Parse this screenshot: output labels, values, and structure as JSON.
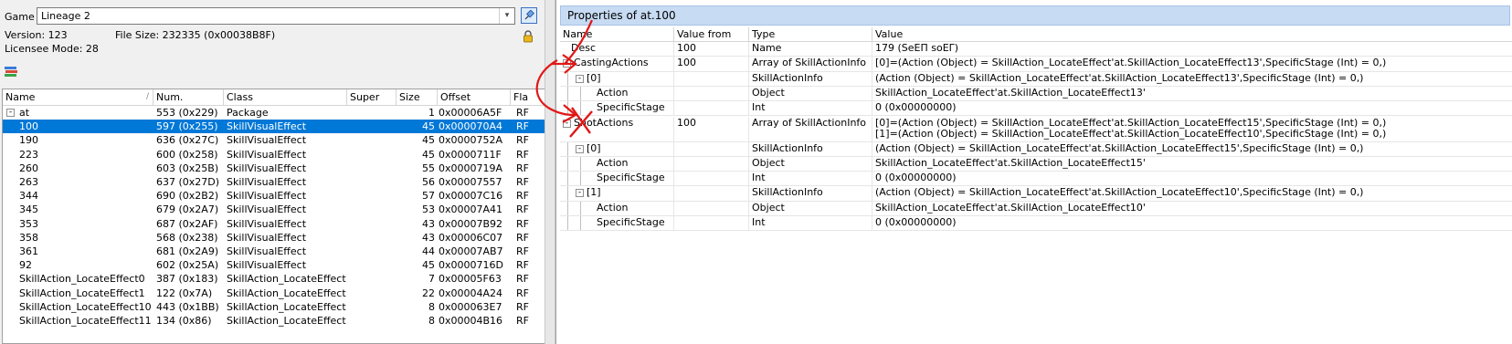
{
  "left": {
    "game_label": "Game",
    "game_value": "Lineage 2",
    "version": "Version: 123",
    "file_size": "File Size: 232335 (0x00038B8F)",
    "licensee_mode": "Licensee Mode: 28",
    "columns": [
      "Name",
      "Num.",
      "Class",
      "Super",
      "Size",
      "Offset",
      "Fla"
    ],
    "rows": [
      {
        "name": "at",
        "num": "553 (0x229)",
        "class": "Package",
        "super": "",
        "size": "1",
        "offset": "0x00006A5F",
        "flags": "RF",
        "expander": "-"
      },
      {
        "name": "100",
        "num": "597 (0x255)",
        "class": "SkillVisualEffect",
        "super": "",
        "size": "45",
        "offset": "0x000070A4",
        "flags": "RF",
        "selected": true
      },
      {
        "name": "190",
        "num": "636 (0x27C)",
        "class": "SkillVisualEffect",
        "super": "",
        "size": "45",
        "offset": "0x0000752A",
        "flags": "RF"
      },
      {
        "name": "223",
        "num": "600 (0x258)",
        "class": "SkillVisualEffect",
        "super": "",
        "size": "45",
        "offset": "0x0000711F",
        "flags": "RF"
      },
      {
        "name": "260",
        "num": "603 (0x25B)",
        "class": "SkillVisualEffect",
        "super": "",
        "size": "55",
        "offset": "0x0000719A",
        "flags": "RF"
      },
      {
        "name": "263",
        "num": "637 (0x27D)",
        "class": "SkillVisualEffect",
        "super": "",
        "size": "56",
        "offset": "0x00007557",
        "flags": "RF"
      },
      {
        "name": "344",
        "num": "690 (0x2B2)",
        "class": "SkillVisualEffect",
        "super": "",
        "size": "57",
        "offset": "0x00007C16",
        "flags": "RF"
      },
      {
        "name": "345",
        "num": "679 (0x2A7)",
        "class": "SkillVisualEffect",
        "super": "",
        "size": "53",
        "offset": "0x00007A41",
        "flags": "RF"
      },
      {
        "name": "353",
        "num": "687 (0x2AF)",
        "class": "SkillVisualEffect",
        "super": "",
        "size": "43",
        "offset": "0x00007B92",
        "flags": "RF"
      },
      {
        "name": "358",
        "num": "568 (0x238)",
        "class": "SkillVisualEffect",
        "super": "",
        "size": "43",
        "offset": "0x00006C07",
        "flags": "RF"
      },
      {
        "name": "361",
        "num": "681 (0x2A9)",
        "class": "SkillVisualEffect",
        "super": "",
        "size": "44",
        "offset": "0x00007AB7",
        "flags": "RF"
      },
      {
        "name": "92",
        "num": "602 (0x25A)",
        "class": "SkillVisualEffect",
        "super": "",
        "size": "45",
        "offset": "0x0000716D",
        "flags": "RF"
      },
      {
        "name": "SkillAction_LocateEffect0",
        "num": "387 (0x183)",
        "class": "SkillAction_LocateEffect",
        "super": "",
        "size": "7",
        "offset": "0x00005F63",
        "flags": "RF"
      },
      {
        "name": "SkillAction_LocateEffect1",
        "num": "122 (0x7A)",
        "class": "SkillAction_LocateEffect",
        "super": "",
        "size": "22",
        "offset": "0x00004A24",
        "flags": "RF"
      },
      {
        "name": "SkillAction_LocateEffect10",
        "num": "443 (0x1BB)",
        "class": "SkillAction_LocateEffect",
        "super": "",
        "size": "8",
        "offset": "0x000063E7",
        "flags": "RF"
      },
      {
        "name": "SkillAction_LocateEffect11",
        "num": "134 (0x86)",
        "class": "SkillAction_LocateEffect",
        "super": "",
        "size": "8",
        "offset": "0x00004B16",
        "flags": "RF"
      }
    ]
  },
  "props": {
    "title": "Properties of at.100",
    "columns": [
      "Name",
      "Value from",
      "Type",
      "Value"
    ],
    "rows": [
      {
        "indent": 0,
        "expander": "",
        "name": "Desc",
        "from": "100",
        "type": "Name",
        "value": "179 (SeEΠ soEΓ)"
      },
      {
        "indent": 0,
        "expander": "-",
        "name": "CastingActions",
        "from": "100",
        "type": "Array of SkillActionInfo",
        "value": "[0]=(Action (Object) = SkillAction_LocateEffect'at.SkillAction_LocateEffect13',SpecificStage (Int) = 0,)"
      },
      {
        "indent": 1,
        "expander": "-",
        "name": "[0]",
        "from": "",
        "type": "SkillActionInfo",
        "value": "(Action (Object) = SkillAction_LocateEffect'at.SkillAction_LocateEffect13',SpecificStage (Int) = 0,)"
      },
      {
        "indent": 2,
        "expander": "",
        "name": "Action",
        "from": "",
        "type": "Object",
        "value": "SkillAction_LocateEffect'at.SkillAction_LocateEffect13'"
      },
      {
        "indent": 2,
        "expander": "",
        "name": "SpecificStage",
        "from": "",
        "type": "Int",
        "value": "0 (0x00000000)"
      },
      {
        "indent": 0,
        "expander": "-",
        "name": "ShotActions",
        "from": "100",
        "type": "Array of SkillActionInfo",
        "value": "[0]=(Action (Object) = SkillAction_LocateEffect'at.SkillAction_LocateEffect15',SpecificStage (Int) = 0,)\n[1]=(Action (Object) = SkillAction_LocateEffect'at.SkillAction_LocateEffect10',SpecificStage (Int) = 0,)",
        "tall": true
      },
      {
        "indent": 1,
        "expander": "-",
        "name": "[0]",
        "from": "",
        "type": "SkillActionInfo",
        "value": "(Action (Object) = SkillAction_LocateEffect'at.SkillAction_LocateEffect15',SpecificStage (Int) = 0,)"
      },
      {
        "indent": 2,
        "expander": "",
        "name": "Action",
        "from": "",
        "type": "Object",
        "value": "SkillAction_LocateEffect'at.SkillAction_LocateEffect15'"
      },
      {
        "indent": 2,
        "expander": "",
        "name": "SpecificStage",
        "from": "",
        "type": "Int",
        "value": "0 (0x00000000)"
      },
      {
        "indent": 1,
        "expander": "-",
        "name": "[1]",
        "from": "",
        "type": "SkillActionInfo",
        "value": "(Action (Object) = SkillAction_LocateEffect'at.SkillAction_LocateEffect10',SpecificStage (Int) = 0,)"
      },
      {
        "indent": 2,
        "expander": "",
        "name": "Action",
        "from": "",
        "type": "Object",
        "value": "SkillAction_LocateEffect'at.SkillAction_LocateEffect10'"
      },
      {
        "indent": 2,
        "expander": "",
        "name": "SpecificStage",
        "from": "",
        "type": "Int",
        "value": "0 (0x00000000)"
      }
    ]
  },
  "colors": {
    "selection": "#0078d7",
    "annotation": "#e01818",
    "title_bar": "#c7dbf3"
  }
}
